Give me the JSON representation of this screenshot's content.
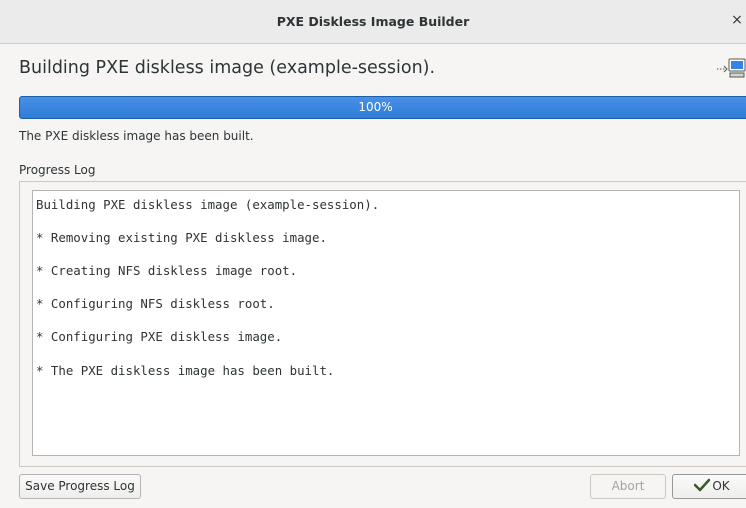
{
  "window": {
    "title": "PXE Diskless Image Builder",
    "close_glyph": "×"
  },
  "header": {
    "heading": "Building PXE diskless image (example-session).",
    "icon": "network-transfer-icon"
  },
  "progress": {
    "value_percent": 100,
    "label": "100%",
    "color": "#3584e4"
  },
  "status": {
    "text": "The PXE diskless image has been built."
  },
  "log": {
    "label": "Progress Log",
    "lines": [
      "Building PXE diskless image (example-session).",
      "* Removing existing PXE diskless image.",
      "* Creating NFS diskless image root.",
      "* Configuring NFS diskless root.",
      "* Configuring PXE diskless image.",
      "* The PXE diskless image has been built."
    ]
  },
  "buttons": {
    "save_label": "Save Progress Log",
    "abort_label": "Abort",
    "ok_label": "OK",
    "ok_icon": "check-icon"
  }
}
